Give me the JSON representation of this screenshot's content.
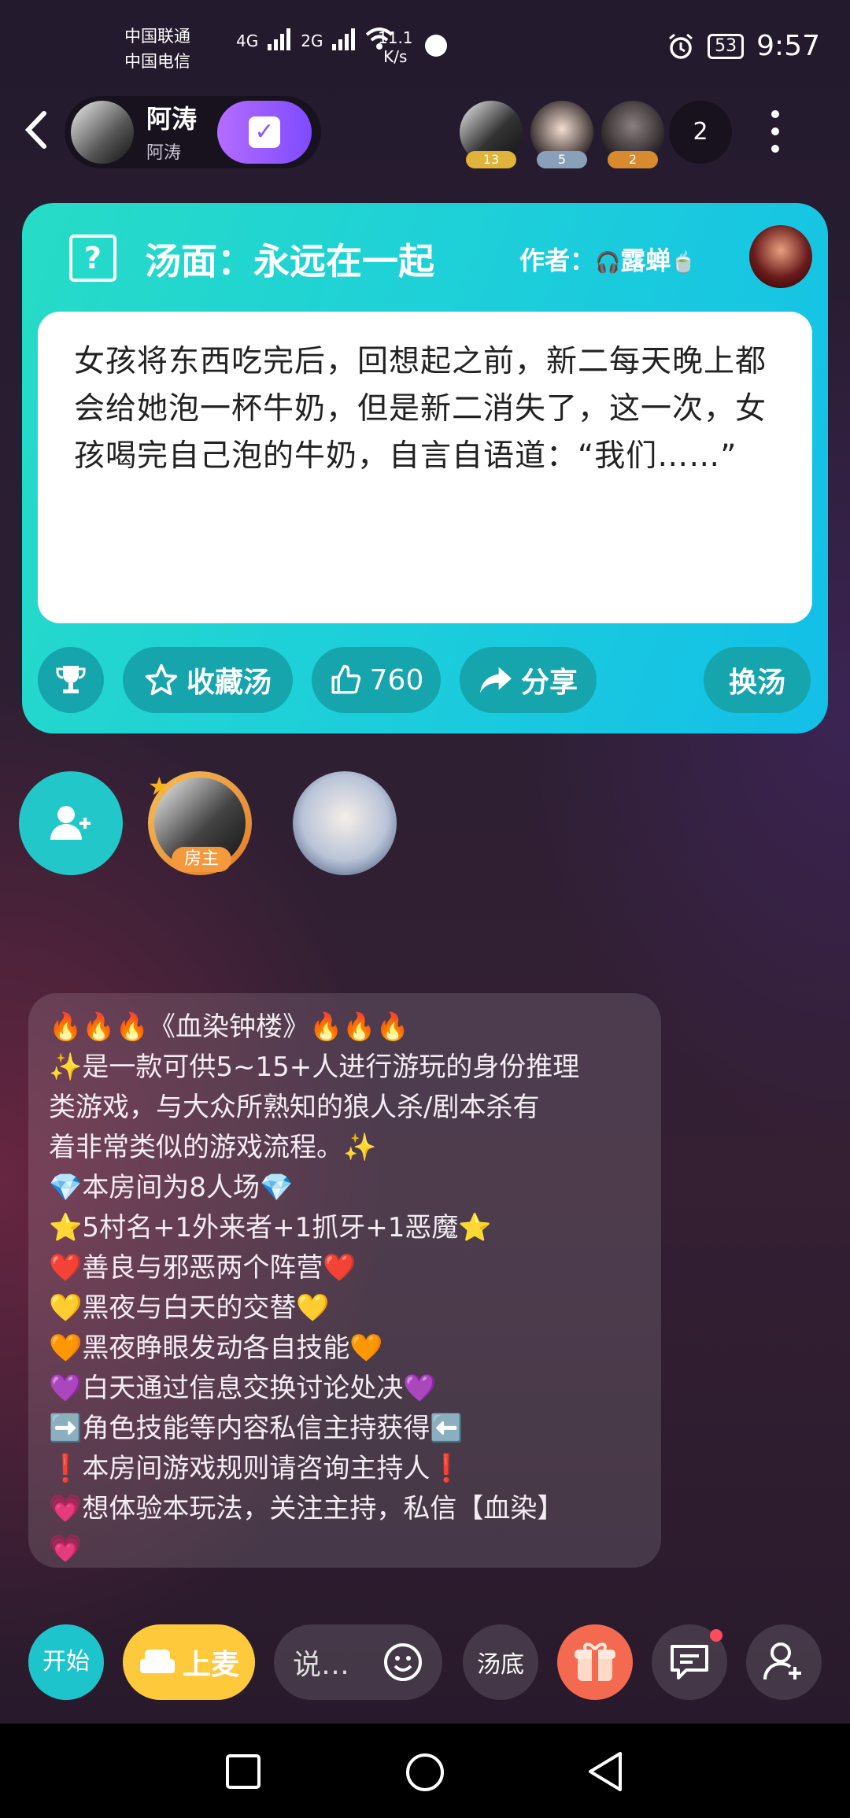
{
  "status_bar": {
    "carrier1": "中国联通",
    "carrier2": "中国电信",
    "net1": "4G",
    "net2": "2G",
    "speed_value": "11.1",
    "speed_unit": "K/s",
    "battery": "53",
    "time": "9:57"
  },
  "header": {
    "host_name": "阿涛",
    "host_sub": "阿涛",
    "audience": [
      {
        "badge": "13",
        "color": "#e0b43a"
      },
      {
        "badge": "5",
        "color": "#8aa0b8"
      },
      {
        "badge": "2",
        "color": "#d88a2e"
      }
    ],
    "audience_count": "2"
  },
  "soup_card": {
    "title": "汤面：永远在一起",
    "author_label": "作者：",
    "author_name": "露蝉",
    "story": "女孩将东西吃完后，回想起之前，新二每天晚上都会给她泡一杯牛奶，但是新二消失了，这一次，女孩喝完自己泡的牛奶，自言自语道：“我们……”",
    "favorite_label": "收藏汤",
    "likes": "760",
    "share_label": "分享",
    "change_label": "换汤"
  },
  "seats": {
    "owner_tag": "房主"
  },
  "notice": {
    "lines": [
      "🔥🔥🔥《血染钟楼》🔥🔥🔥",
      "✨是一款可供5~15+人进行游玩的身份推理",
      "类游戏，与大众所熟知的狼人杀/剧本杀有",
      "着非常类似的游戏流程。✨",
      "💎本房间为8人场💎",
      "⭐5村名+1外来者+1抓牙+1恶魔⭐",
      "❤️善良与邪恶两个阵营❤️",
      "💛黑夜与白天的交替💛",
      "🧡黑夜睁眼发动各自技能🧡",
      "💜白天通过信息交换讨论处决💜",
      "➡️角色技能等内容私信主持获得⬅️",
      "❗本房间游戏规则请咨询主持人❗",
      "💗想体验本玩法，关注主持，私信【血染】",
      "💗"
    ]
  },
  "toolbar": {
    "start_label": "开始",
    "mic_label": "上麦",
    "say_placeholder": "说…",
    "answer_label": "汤底"
  }
}
